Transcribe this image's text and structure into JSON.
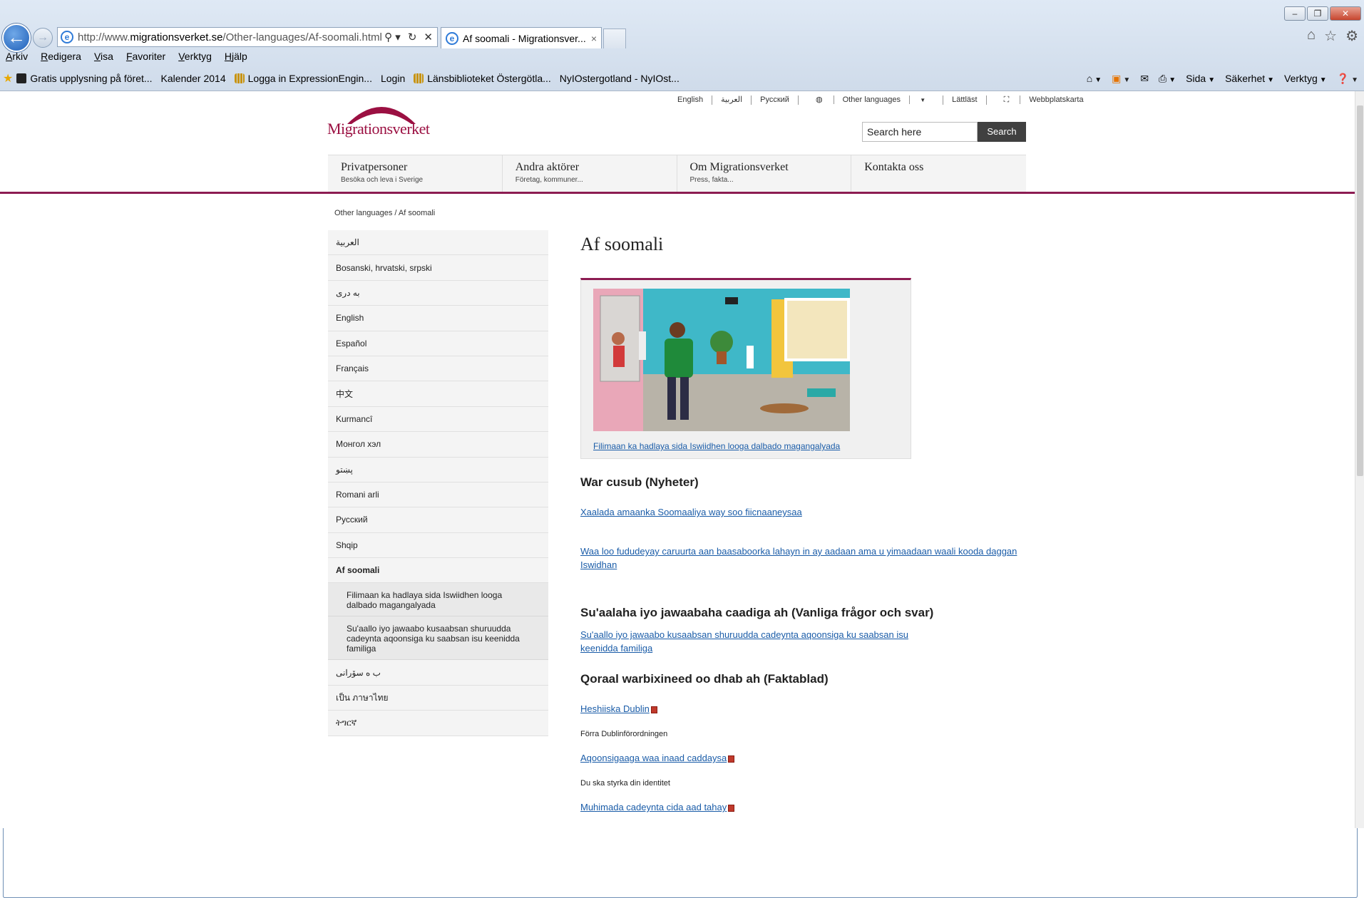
{
  "browser": {
    "url_prefix": "http://www.",
    "url_domain": "migrationsverket.se",
    "url_path": "/Other-languages/Af-soomali.html",
    "tab_title": "Af soomali - Migrationsver...",
    "tab_close": "×",
    "window_min": "–",
    "window_max": "❐",
    "window_close": "✕",
    "addr_tools": [
      "⚲ ▾",
      "↻",
      "✕"
    ],
    "right_icons": [
      "⌂",
      "☆",
      "⚙"
    ],
    "menu": [
      "Arkiv",
      "Redigera",
      "Visa",
      "Favoriter",
      "Verktyg",
      "Hjälp"
    ],
    "favorites": [
      "Gratis upplysning på föret...",
      "Kalender 2014",
      "Logga in  ExpressionEngin...",
      "Login",
      "Länsbiblioteket Östergötla...",
      "NyIOstergotland - NyIOst..."
    ],
    "commands": [
      "Sida",
      "Säkerhet",
      "Verktyg"
    ]
  },
  "site": {
    "logo_text": "Migrationsverket",
    "util_links": [
      "English",
      "العربية",
      "Русский",
      "Other languages",
      "Lättläst",
      "Webbplatskarta"
    ],
    "search_value": "Search here",
    "search_button": "Search",
    "nav": [
      {
        "title": "Privatpersoner",
        "sub": "Besöka och leva i Sverige"
      },
      {
        "title": "Andra aktörer",
        "sub": "Företag, kommuner..."
      },
      {
        "title": "Om Migrationsverket",
        "sub": "Press, fakta..."
      },
      {
        "title": "Kontakta oss",
        "sub": ""
      }
    ],
    "breadcrumb": "Other languages / Af soomali"
  },
  "sidebar": {
    "items": [
      "العربية",
      "Bosanski, hrvatski, srpski",
      "به دری",
      "English",
      "Español",
      "Français",
      "中文",
      "Kurmancî",
      "Монгол хэл",
      "پښتو",
      "Romani arli",
      "Русский",
      "Shqip",
      "Af soomali"
    ],
    "subs": [
      "Filimaan ka hadlaya sida Iswiidhen looga dalbado magangalyada",
      "Su'aallo iyo jawaabo kusaabsan shuruudda cadeynta aqoonsiga ku saabsan isu keenidda familiga"
    ],
    "after": [
      "ب ه سۆرانی",
      "เป็น ภาษาไทย",
      "ትግርኛ"
    ]
  },
  "content": {
    "title": "Af soomali",
    "media_link": "Filimaan ka hadlaya sida Iswiidhen  looga dalbado magangalyada",
    "news_heading": "War cusub (Nyheter)",
    "news_1": "Xaalada amaanka Soomaaliya way soo fiicnaaneysaa",
    "news_2": "Waa loo fududeyay  caruurta aan baasaboorka lahayn   in ay aadaan ama u yimaadaan waali kooda daggan Iswidhan",
    "faq_heading": "Su'aalaha iyo jawaabaha caadiga ah (Vanliga frågor och svar)",
    "faq_link": "Su'aallo iyo jawaabo kusaabsan shuruudda cadeynta aqoonsiga ku saabsan isu keenidda familiga ",
    "facts_heading": "Qoraal  warbixineed oo dhab ah (Faktablad)",
    "fact_1_link": "Heshiiska Dublin",
    "fact_1_desc": "Förra Dublinförordningen",
    "fact_2_link": "Aqoonsigaaga waa inaad caddaysa",
    "fact_2_desc": "Du ska styrka din identitet",
    "fact_3_link": "Muhimada cadeynta cida aad tahay"
  }
}
